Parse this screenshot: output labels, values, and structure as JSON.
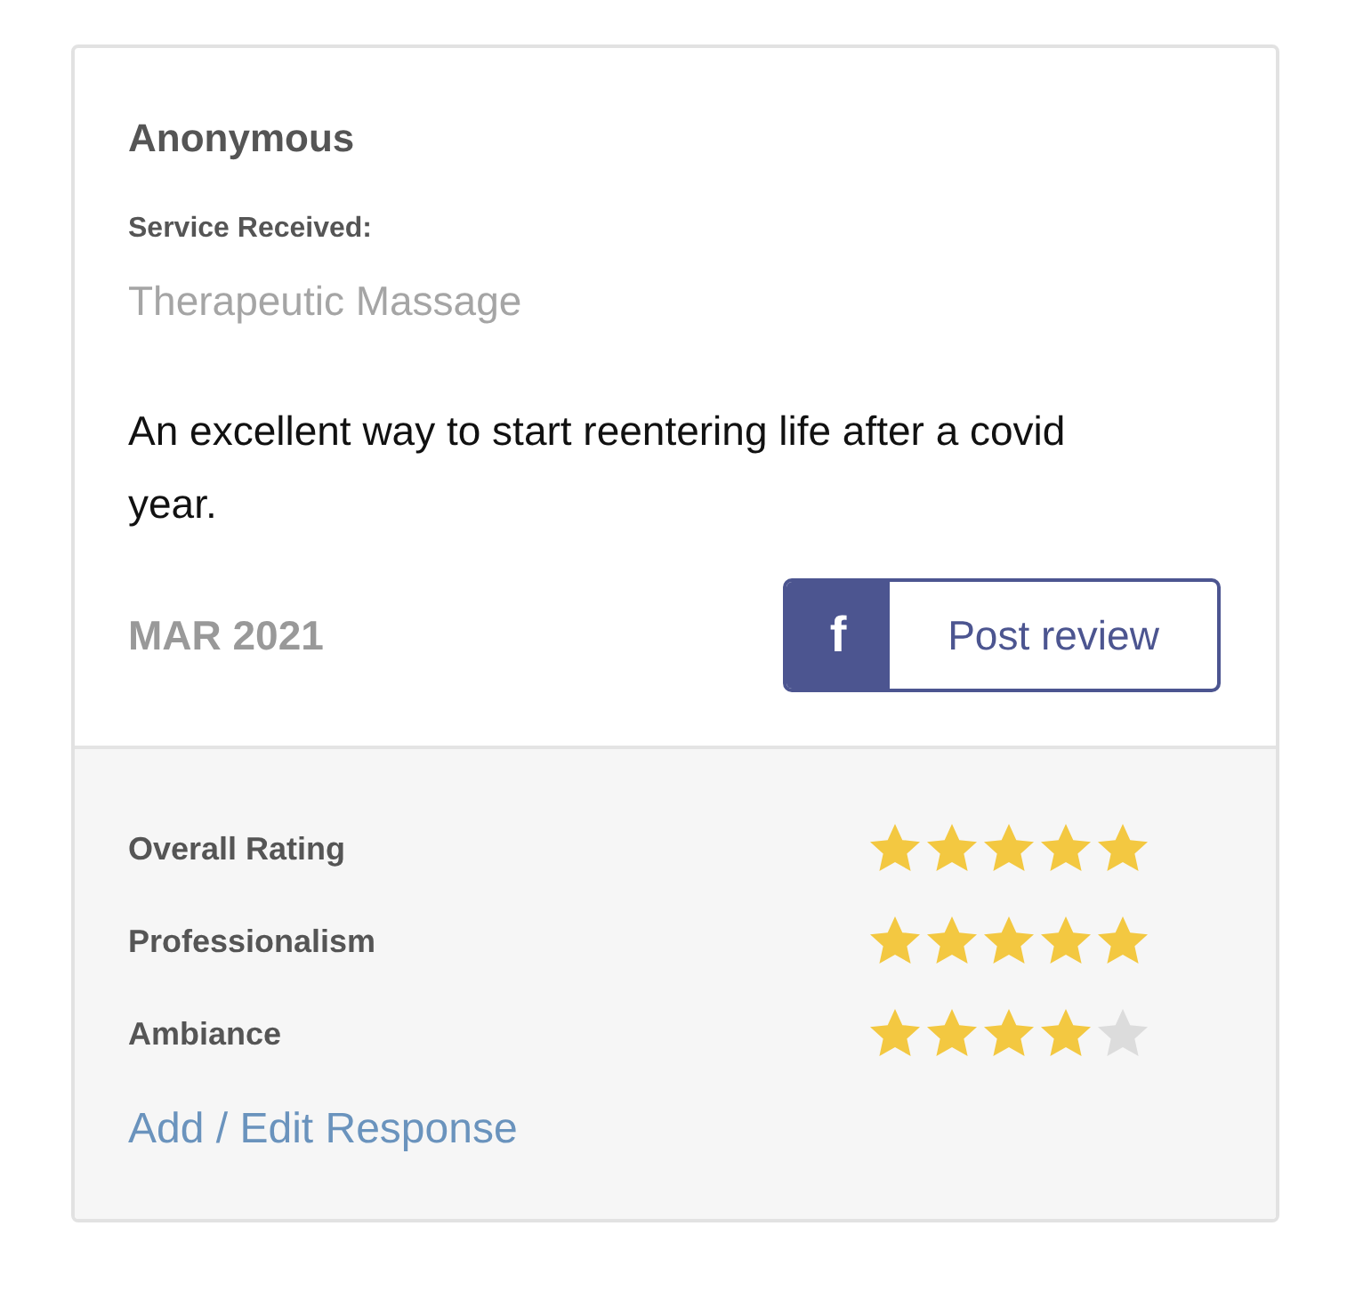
{
  "review": {
    "author": "Anonymous",
    "service_label": "Service Received:",
    "service": "Therapeutic Massage",
    "text": "An excellent way to start reentering life after a covid year.",
    "date": "MAR 2021",
    "share_button": {
      "icon": "f",
      "label": "Post review"
    }
  },
  "ratings": [
    {
      "label": "Overall Rating",
      "stars": 5
    },
    {
      "label": "Professionalism",
      "stars": 5
    },
    {
      "label": "Ambiance",
      "stars": 4
    }
  ],
  "response_link": "Add / Edit Response"
}
